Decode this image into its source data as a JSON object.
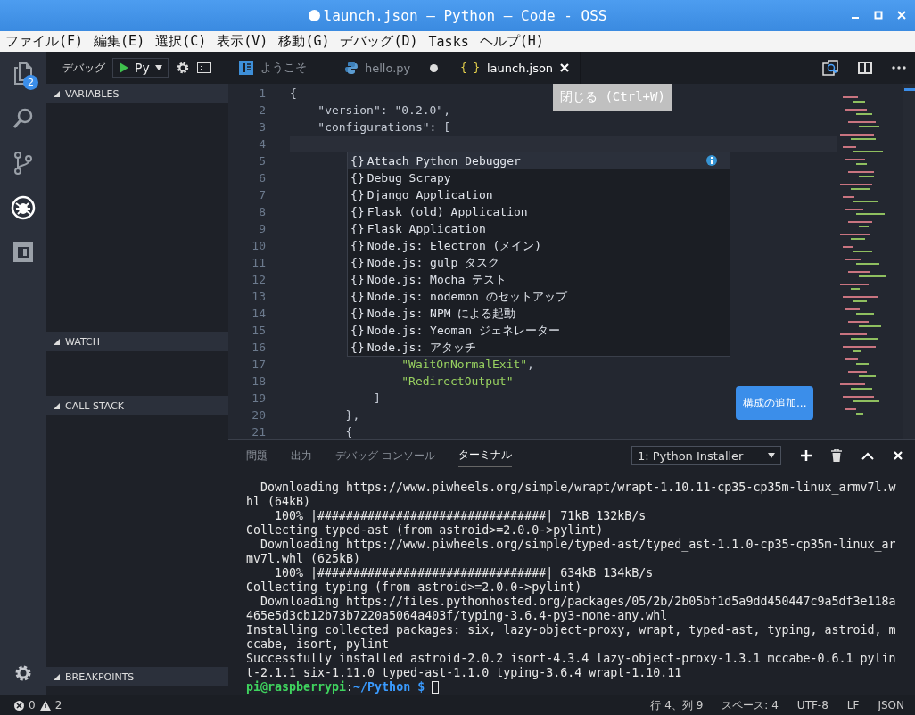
{
  "window": {
    "title": "launch.json — Python — Code - OSS",
    "dirty": true
  },
  "menu": [
    "ファイル(F)",
    "編集(E)",
    "選択(C)",
    "表示(V)",
    "移動(G)",
    "デバッグ(D)",
    "Tasks",
    "ヘルプ(H)"
  ],
  "activity_bar": [
    {
      "kind": "files",
      "selected": false,
      "badge": "2"
    },
    {
      "kind": "search",
      "selected": false
    },
    {
      "kind": "scm",
      "selected": false
    },
    {
      "kind": "debug",
      "selected": true
    },
    {
      "kind": "extensions",
      "selected": false
    }
  ],
  "debug_toolbar": {
    "label": "デバッグ",
    "configuration": "Py"
  },
  "sidebar": {
    "sections": [
      {
        "title": "VARIABLES",
        "expanded": true
      },
      {
        "title": "WATCH",
        "expanded": true
      },
      {
        "title": "CALL STACK",
        "expanded": true
      },
      {
        "title": "BREAKPOINTS",
        "expanded": true
      }
    ]
  },
  "tabs": [
    {
      "label": "ようこそ",
      "kind": "welcome",
      "selected": false,
      "dirty": false
    },
    {
      "label": "hello.py",
      "kind": "python",
      "selected": false,
      "dirty": true
    },
    {
      "label": "launch.json",
      "kind": "json",
      "icon": "{ }",
      "selected": true,
      "dirty": false
    }
  ],
  "tooltip": "閉じる (Ctrl+W)",
  "code": [
    {
      "n": "1",
      "segments": [
        {
          "text": "{",
          "kind": "punct"
        }
      ]
    },
    {
      "n": "2",
      "segments": [
        {
          "text": "    \"version\": \"0.2.0\",",
          "kind": "punct"
        }
      ]
    },
    {
      "n": "3",
      "segments": [
        {
          "text": "    \"configurations\": [",
          "kind": "punct"
        }
      ]
    },
    {
      "n": "4",
      "current": true
    },
    {
      "n": "5"
    },
    {
      "n": "6"
    },
    {
      "n": "7"
    },
    {
      "n": "8"
    },
    {
      "n": "9"
    },
    {
      "n": "10"
    },
    {
      "n": "11"
    },
    {
      "n": "12"
    },
    {
      "n": "13"
    },
    {
      "n": "14"
    },
    {
      "n": "15"
    },
    {
      "n": "16"
    },
    {
      "n": "17",
      "segments": [
        {
          "text": "                \"WaitOnNormalExit\"",
          "kind": "string"
        },
        {
          "text": ",",
          "kind": "punct"
        }
      ]
    },
    {
      "n": "18",
      "segments": [
        {
          "text": "                \"RedirectOutput\"",
          "kind": "string"
        }
      ]
    },
    {
      "n": "19",
      "segments": [
        {
          "text": "            ]",
          "kind": "punct"
        }
      ]
    },
    {
      "n": "20",
      "segments": [
        {
          "text": "        },",
          "kind": "punct"
        }
      ]
    },
    {
      "n": "21",
      "segments": [
        {
          "text": "        {",
          "kind": "punct"
        }
      ]
    }
  ],
  "suggestions": [
    {
      "icon": "{}",
      "label": "Attach Python Debugger",
      "selected": true
    },
    {
      "icon": "{}",
      "label": "Debug Scrapy",
      "selected": false
    },
    {
      "icon": "{}",
      "label": "Django Application",
      "selected": false
    },
    {
      "icon": "{}",
      "label": "Flask (old) Application",
      "selected": false
    },
    {
      "icon": "{}",
      "label": "Flask Application",
      "selected": false
    },
    {
      "icon": "{}",
      "label": "Node.js: Electron (メイン)",
      "selected": false
    },
    {
      "icon": "{}",
      "label": "Node.js: gulp タスク",
      "selected": false
    },
    {
      "icon": "{}",
      "label": "Node.js: Mocha テスト",
      "selected": false
    },
    {
      "icon": "{}",
      "label": "Node.js: nodemon のセットアップ",
      "selected": false
    },
    {
      "icon": "{}",
      "label": "Node.js: NPM による起動",
      "selected": false
    },
    {
      "icon": "{}",
      "label": "Node.js: Yeoman ジェネレーター",
      "selected": false
    },
    {
      "icon": "{}",
      "label": "Node.js: アタッチ",
      "selected": false
    }
  ],
  "add_configuration_button": "構成の追加...",
  "panel": {
    "tabs": [
      {
        "label": "問題",
        "selected": false
      },
      {
        "label": "出力",
        "selected": false
      },
      {
        "label": "デバッグ コンソール",
        "selected": false
      },
      {
        "label": "ターミナル",
        "selected": true
      }
    ],
    "terminal_select": "1: Python Installer",
    "terminal_lines": [
      "  Downloading https://www.piwheels.org/simple/wrapt/wrapt-1.10.11-cp35-cp35m-linux_armv7l.w",
      "hl (64kB)",
      "    100% |################################| 71kB 132kB/s",
      "Collecting typed-ast (from astroid>=2.0.0->pylint)",
      "  Downloading https://www.piwheels.org/simple/typed-ast/typed_ast-1.1.0-cp35-cp35m-linux_ar",
      "mv7l.whl (625kB)",
      "    100% |################################| 634kB 134kB/s",
      "Collecting typing (from astroid>=2.0.0->pylint)",
      "  Downloading https://files.pythonhosted.org/packages/05/2b/2b05bf1d5a9dd450447c9a5df3e118a",
      "465e5d3cb12b73b7220a5064a403f/typing-3.6.4-py3-none-any.whl",
      "Installing collected packages: six, lazy-object-proxy, wrapt, typed-ast, typing, astroid, m",
      "ccabe, isort, pylint",
      "Successfully installed astroid-2.0.2 isort-4.3.4 lazy-object-proxy-1.3.1 mccabe-0.6.1 pylin",
      "t-2.1.1 six-1.11.0 typed-ast-1.1.0 typing-3.6.4 wrapt-1.10.11"
    ],
    "prompt": {
      "user": "pi@raspberrypi",
      "separator": ":",
      "path": "~/Python $"
    }
  },
  "status_bar": {
    "errors": "0",
    "warnings": "2",
    "items": [
      "行 4、列 9",
      "スペース: 4",
      "UTF-8",
      "LF",
      "JSON"
    ]
  }
}
